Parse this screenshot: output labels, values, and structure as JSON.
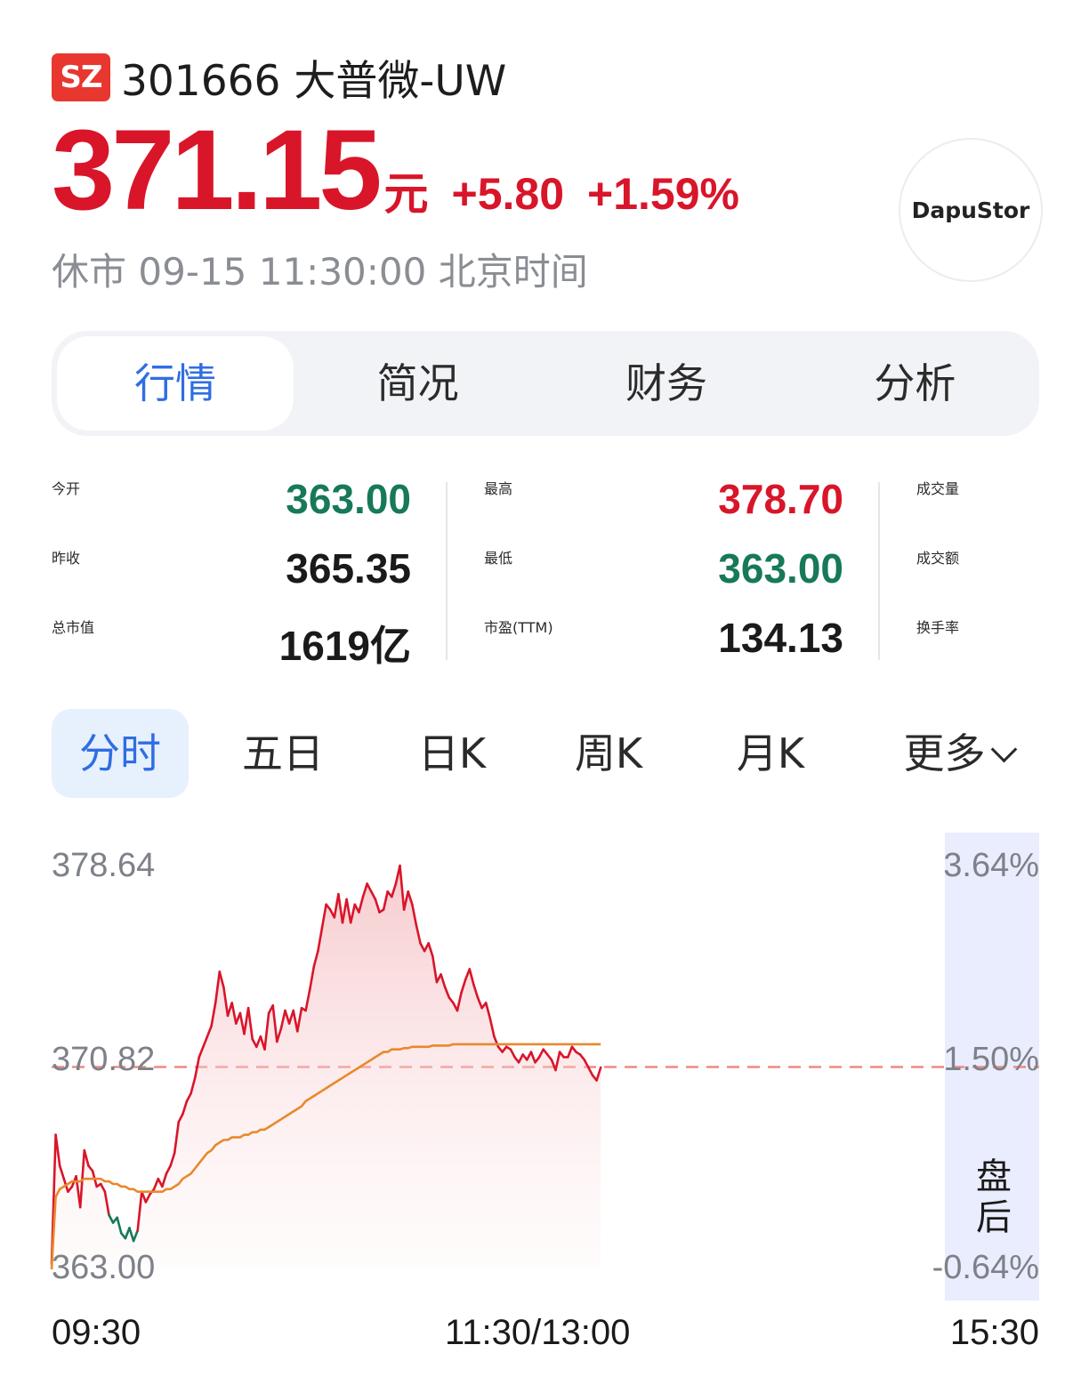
{
  "header": {
    "exchange_badge": "SZ",
    "title": "301666 大普微-UW",
    "price": "371.15",
    "unit": "元",
    "change": "+5.80",
    "change_pct": "+1.59%",
    "status": "休市 09-15 11:30:00 北京时间",
    "logo_text": "DapuStor"
  },
  "tabs": [
    {
      "label": "行情",
      "active": true
    },
    {
      "label": "简况"
    },
    {
      "label": "财务"
    },
    {
      "label": "分析"
    }
  ],
  "stats": {
    "col1": [
      {
        "label": "今开",
        "value": "363.00",
        "color": "green"
      },
      {
        "label": "昨收",
        "value": "365.35",
        "color": "dark"
      },
      {
        "label": "总市值",
        "value": "1619亿",
        "color": "dark"
      }
    ],
    "col2": [
      {
        "label": "最高",
        "value": "378.70",
        "color": "red"
      },
      {
        "label": "最低",
        "value": "363.00",
        "color": "green"
      },
      {
        "label": "市盈(TTM)",
        "value": "134.13",
        "color": "dark"
      }
    ],
    "col3": [
      {
        "label": "成交量"
      },
      {
        "label": "成交额"
      },
      {
        "label": "换手率"
      }
    ]
  },
  "periods": [
    "分时",
    "五日",
    "日K",
    "周K",
    "月K",
    "更多"
  ],
  "chart": {
    "y_left": [
      "378.64",
      "370.82",
      "363.00"
    ],
    "y_right": [
      "3.64%",
      "1.50%",
      "-0.64%"
    ],
    "x_labels": [
      "09:30",
      "11:30/13:00",
      "15:30"
    ],
    "after_hours_label": "盘后",
    "colors": {
      "up": "#d9152a",
      "down": "#17795a",
      "avg": "#e8892b",
      "ref": "#f08a84"
    }
  },
  "chart_data": {
    "type": "line",
    "ylim": [
      363.0,
      378.64
    ],
    "reference": 370.82,
    "x_range": [
      0,
      241
    ],
    "price": [
      363.2,
      368.2,
      367.0,
      366.5,
      366.0,
      366.2,
      366.6,
      365.4,
      367.6,
      367.0,
      366.8,
      366.2,
      366.3,
      366.0,
      365.1,
      364.8,
      365.0,
      364.4,
      364.2,
      364.6,
      364.1,
      364.5,
      366.0,
      365.6,
      365.9,
      366.1,
      366.5,
      366.2,
      366.7,
      367.0,
      367.5,
      368.7,
      369.0,
      369.5,
      369.8,
      370.4,
      371.2,
      371.6,
      372.0,
      372.4,
      373.3,
      374.5,
      373.9,
      372.8,
      373.3,
      372.5,
      372.9,
      372.1,
      373.1,
      371.9,
      371.6,
      372.0,
      371.5,
      372.9,
      373.2,
      371.8,
      372.3,
      373.0,
      372.5,
      373.0,
      372.2,
      373.1,
      373.0,
      373.8,
      374.7,
      375.3,
      376.2,
      377.1,
      376.9,
      376.6,
      377.5,
      376.4,
      377.3,
      376.4,
      377.1,
      376.8,
      377.4,
      377.9,
      377.6,
      377.3,
      376.8,
      376.9,
      377.6,
      377.4,
      377.9,
      378.6,
      376.9,
      377.6,
      377.1,
      376.3,
      375.6,
      375.3,
      375.6,
      375.1,
      374.1,
      374.4,
      373.9,
      373.5,
      373.3,
      373.0,
      373.7,
      374.2,
      374.6,
      374.0,
      373.5,
      373.1,
      373.3,
      372.7,
      372.0,
      371.6,
      371.4,
      371.6,
      371.5,
      371.2,
      371.0,
      371.3,
      371.1,
      371.4,
      371.0,
      371.2,
      371.5,
      371.3,
      371.1,
      370.7,
      371.4,
      371.2,
      371.2,
      371.6,
      371.4,
      371.3,
      371.1,
      370.8,
      370.5,
      370.3,
      370.8
    ],
    "avg": [
      363.0,
      365.8,
      366.1,
      366.2,
      366.3,
      366.4,
      366.4,
      366.4,
      366.5,
      366.5,
      366.5,
      366.5,
      366.5,
      366.4,
      366.4,
      366.3,
      366.3,
      366.2,
      366.2,
      366.1,
      366.1,
      366.0,
      366.0,
      366.0,
      366.0,
      366.0,
      366.0,
      366.0,
      366.1,
      366.1,
      366.2,
      366.3,
      366.5,
      366.6,
      366.7,
      366.9,
      367.1,
      367.3,
      367.5,
      367.6,
      367.8,
      367.9,
      368.0,
      368.0,
      368.1,
      368.1,
      368.1,
      368.2,
      368.2,
      368.3,
      368.3,
      368.4,
      368.4,
      368.5,
      368.6,
      368.7,
      368.8,
      368.9,
      369.0,
      369.1,
      369.2,
      369.3,
      369.5,
      369.6,
      369.7,
      369.8,
      369.9,
      370.0,
      370.1,
      370.2,
      370.3,
      370.4,
      370.5,
      370.6,
      370.7,
      370.8,
      370.9,
      371.0,
      371.1,
      371.2,
      371.3,
      371.4,
      371.4,
      371.5,
      371.5,
      371.5,
      371.55,
      371.55,
      371.6,
      371.6,
      371.6,
      371.6,
      371.6,
      371.65,
      371.65,
      371.65,
      371.65,
      371.65,
      371.7,
      371.7,
      371.7,
      371.7,
      371.7,
      371.7,
      371.7,
      371.7,
      371.7,
      371.7,
      371.7,
      371.7,
      371.7,
      371.7,
      371.7,
      371.7,
      371.7,
      371.7,
      371.7,
      371.7,
      371.7,
      371.7,
      371.7,
      371.7,
      371.7,
      371.7,
      371.7,
      371.7,
      371.7,
      371.7,
      371.7,
      371.7,
      371.7,
      371.7,
      371.7,
      371.7,
      371.7
    ]
  }
}
